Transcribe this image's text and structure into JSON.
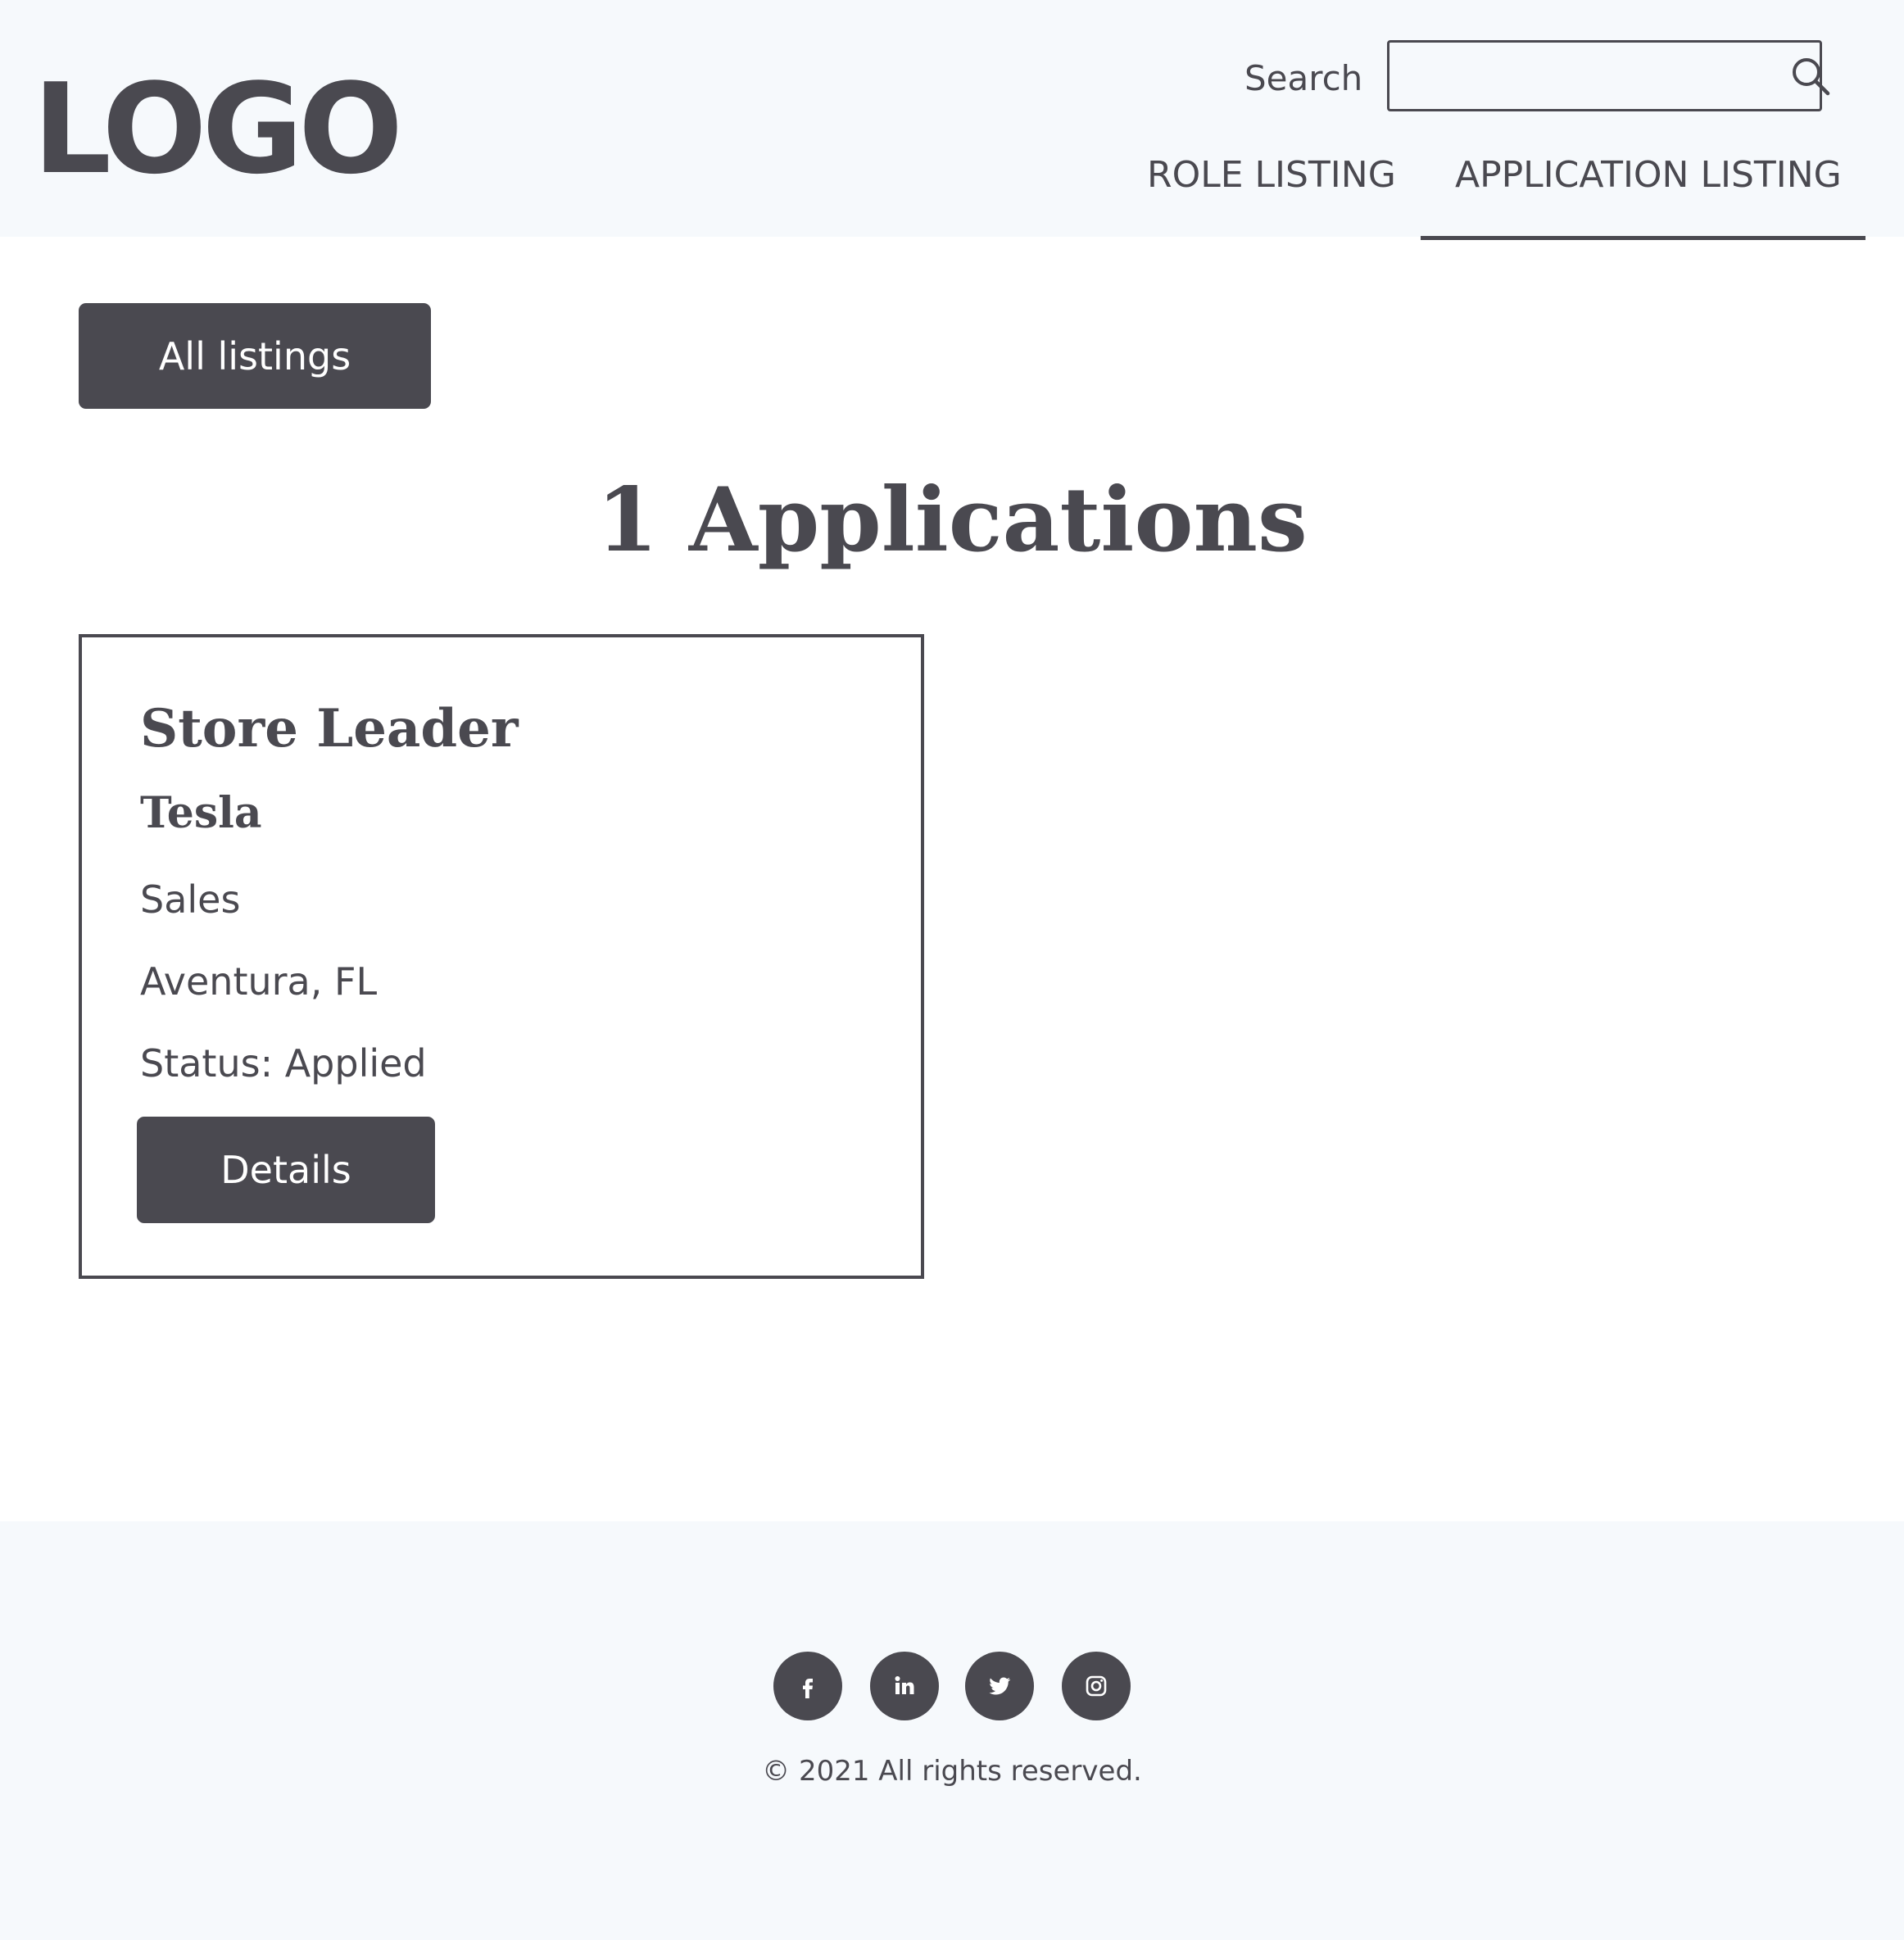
{
  "header": {
    "logo_text": "LOGO",
    "search_label": "Search",
    "search_placeholder": "",
    "search_value": "",
    "nav": [
      {
        "label": "ROLE LISTING",
        "active": false
      },
      {
        "label": "APPLICATION LISTING",
        "active": true
      }
    ]
  },
  "main": {
    "all_listings_label": "All listings",
    "title": "1 Applications",
    "applications": [
      {
        "role": "Store Leader",
        "company": "Tesla",
        "department": "Sales",
        "location": "Aventura, FL",
        "status": "Status: Applied",
        "details_label": "Details"
      }
    ]
  },
  "footer": {
    "social_icons": [
      "facebook-icon",
      "linkedin-icon",
      "twitter-icon",
      "instagram-icon"
    ],
    "copyright": "© 2021 All rights reserved."
  },
  "colors": {
    "primary": "#4a4950",
    "header_bg": "#f6f9fc",
    "page_bg": "#ffffff"
  }
}
